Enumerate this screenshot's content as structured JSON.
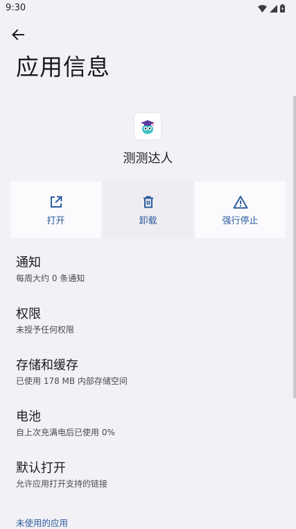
{
  "status": {
    "time": "9:30"
  },
  "header": {
    "title": "应用信息"
  },
  "app": {
    "name": "测测达人"
  },
  "actions": [
    {
      "label": "打开",
      "icon": "open-in-new-icon"
    },
    {
      "label": "卸载",
      "icon": "trash-icon"
    },
    {
      "label": "强行停止",
      "icon": "warning-icon"
    }
  ],
  "settings": [
    {
      "title": "通知",
      "subtitle": "每周大约 0 条通知"
    },
    {
      "title": "权限",
      "subtitle": "未授予任何权限"
    },
    {
      "title": "存储和缓存",
      "subtitle": "已使用 178 MB 内部存储空间"
    },
    {
      "title": "电池",
      "subtitle": "自上次充满电后已使用 0%"
    },
    {
      "title": "默认打开",
      "subtitle": "允许应用打开支持的链接"
    }
  ],
  "section": {
    "unused_apps": "未使用的应用"
  },
  "colors": {
    "background": "#F2F1F6",
    "accent": "#2B5C9E",
    "card": "#FBFBFD"
  }
}
